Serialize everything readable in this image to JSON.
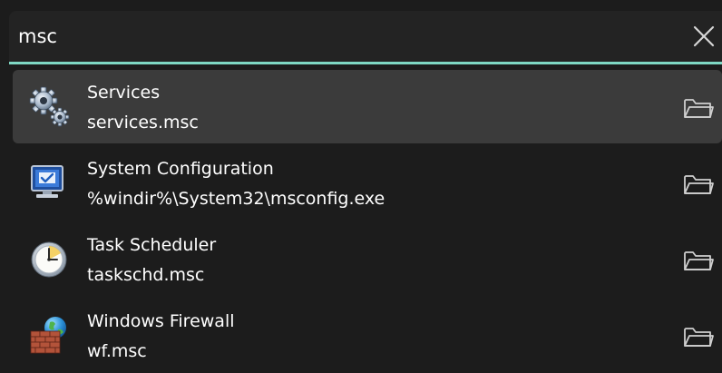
{
  "search": {
    "query": "msc"
  },
  "colors": {
    "accent": "#7fd8c4",
    "selected_row": "#3b3b3b",
    "background": "#1c1c1c"
  },
  "results": [
    {
      "title": "Services",
      "path": "services.msc",
      "icon": "gears-icon",
      "selected": true
    },
    {
      "title": "System Configuration",
      "path": "%windir%\\System32\\msconfig.exe",
      "icon": "monitor-checkmark-icon",
      "selected": false
    },
    {
      "title": "Task Scheduler",
      "path": "taskschd.msc",
      "icon": "clock-icon",
      "selected": false
    },
    {
      "title": "Windows Firewall",
      "path": "wf.msc",
      "icon": "firewall-brick-globe-icon",
      "selected": false
    }
  ],
  "actions": {
    "clear": "close-icon",
    "open_folder": "folder-icon"
  }
}
